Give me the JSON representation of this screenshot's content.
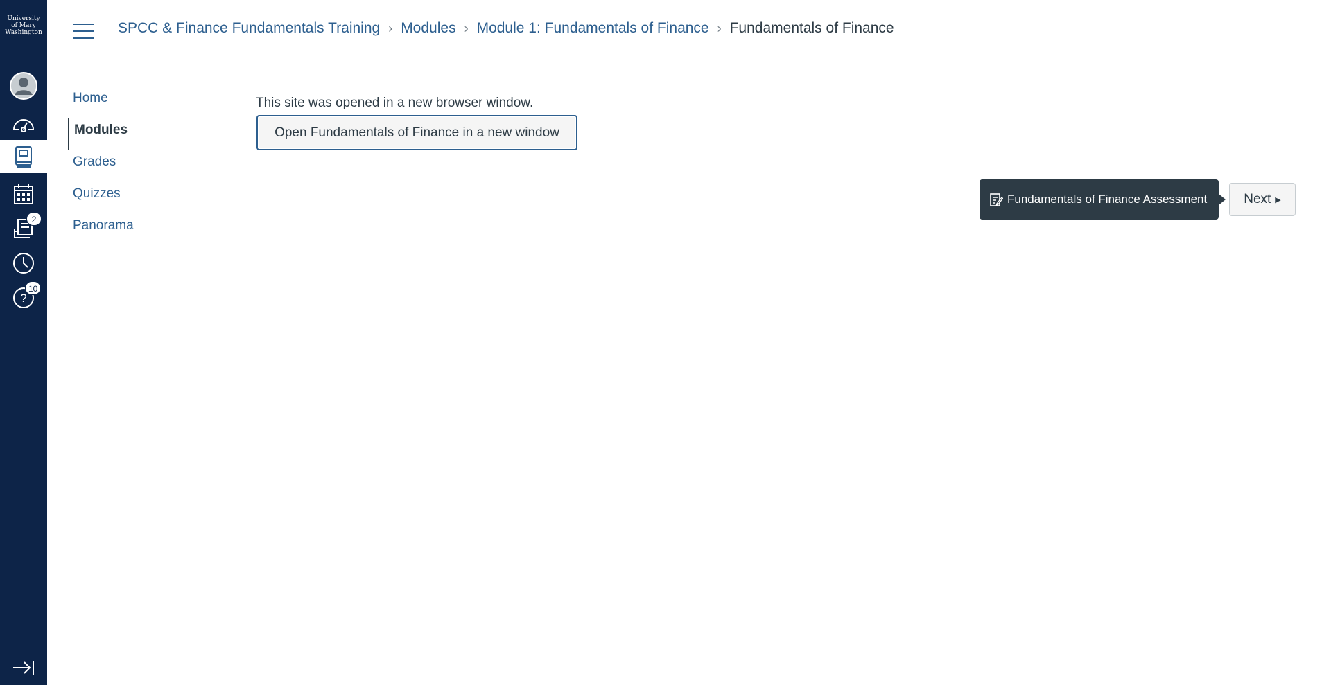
{
  "logo": {
    "line1": "University",
    "line2": "of Mary",
    "line3": "Washington"
  },
  "global_nav": {
    "items": [
      {
        "name": "account",
        "icon": "avatar-icon"
      },
      {
        "name": "dashboard",
        "icon": "dashboard-icon"
      },
      {
        "name": "courses",
        "icon": "courses-icon",
        "active": true
      },
      {
        "name": "calendar",
        "icon": "calendar-icon"
      },
      {
        "name": "inbox",
        "icon": "inbox-icon",
        "badge": "2"
      },
      {
        "name": "history",
        "icon": "clock-icon"
      },
      {
        "name": "help",
        "icon": "help-icon",
        "badge": "10"
      }
    ],
    "collapse_icon": "collapse-icon"
  },
  "breadcrumb": {
    "items": [
      "SPCC & Finance Fundamentals Training",
      "Modules",
      "Module 1: Fundamentals of Finance"
    ],
    "current": "Fundamentals of Finance"
  },
  "course_nav": {
    "items": [
      "Home",
      "Modules",
      "Grades",
      "Quizzes",
      "Panorama"
    ],
    "active": "Modules"
  },
  "content": {
    "message": "This site was opened in a new browser window.",
    "open_button": "Open Fundamentals of Finance in a new window"
  },
  "footer_nav": {
    "tooltip": "Fundamentals of Finance Assessment",
    "next_label": "Next"
  },
  "colors": {
    "nav_bg": "#0d2448",
    "link": "#2d5f8f",
    "text": "#2d3b45",
    "tooltip_bg": "#2d3b45"
  }
}
